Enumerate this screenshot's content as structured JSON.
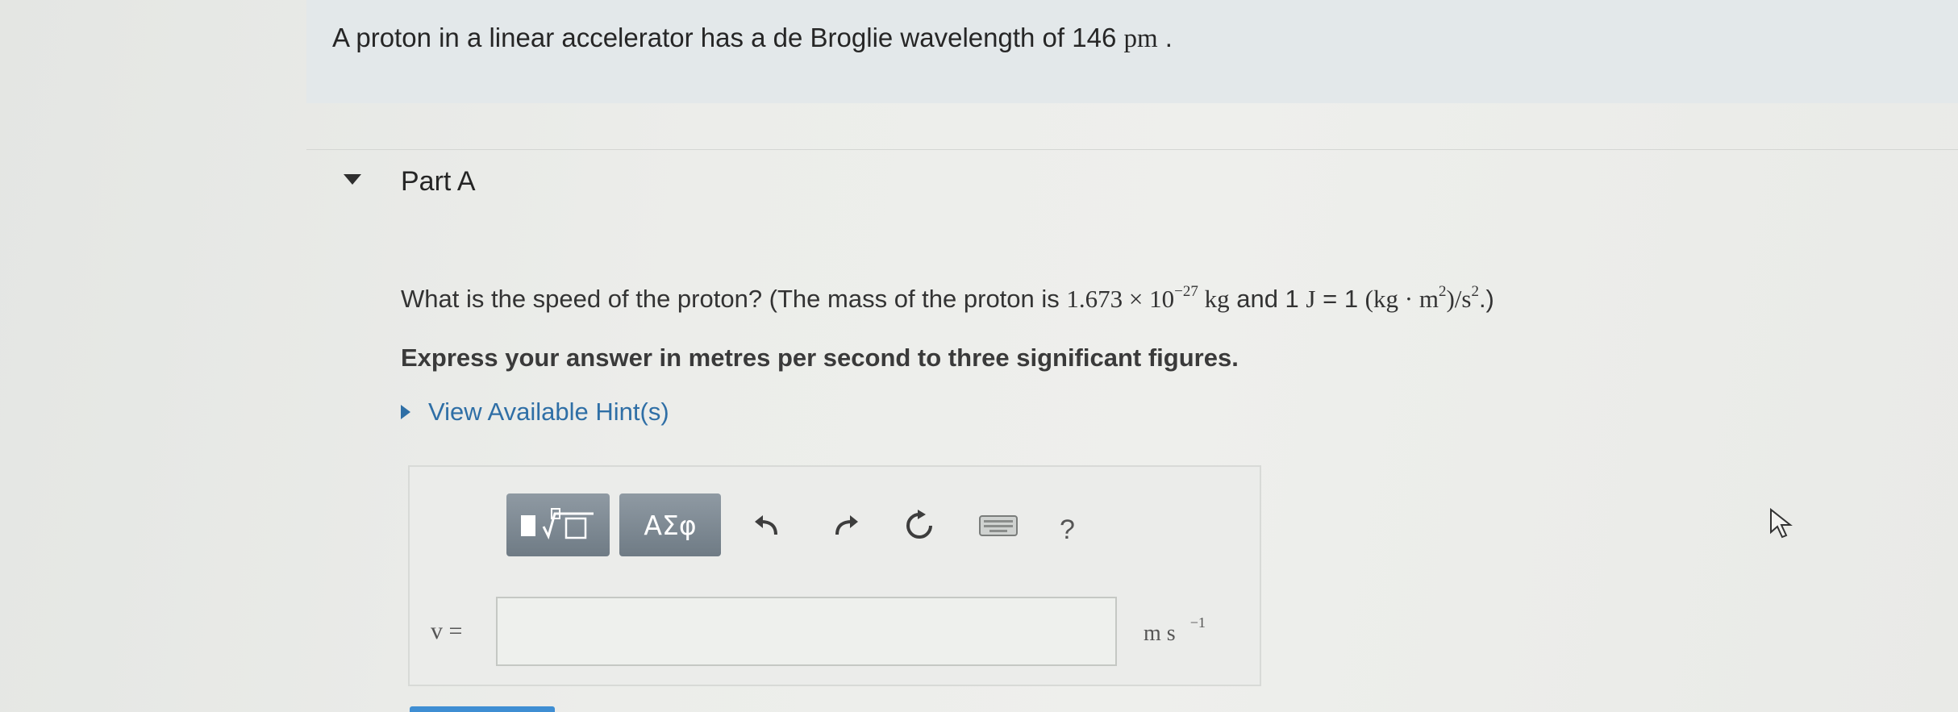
{
  "problem": {
    "text_before": "A proton in a linear accelerator has a de Broglie wavelength of 146 ",
    "unit": "pm",
    "text_after": " ."
  },
  "part": {
    "title": "Part A"
  },
  "question": {
    "lead": "What is the speed of the proton? (The mass of the proton is ",
    "mass_value": "1.673 × 10",
    "mass_exp": "−27",
    "mass_unit": " kg",
    "and_text": " and 1 ",
    "joule_unit": "J",
    "equals_text": " = 1 ",
    "joule_def_open": "(kg · m",
    "sq1": "2",
    "joule_def_mid": ")/s",
    "sq2": "2",
    "close": ".)"
  },
  "instruction": "Express your answer in metres per second to three significant figures.",
  "hints": {
    "label": "View Available Hint(s)"
  },
  "toolbar": {
    "symbols_label": "ΑΣφ",
    "help_label": "?"
  },
  "answer": {
    "variable": "v =",
    "value": "",
    "unit": "m s",
    "unit_exp": "−1"
  }
}
